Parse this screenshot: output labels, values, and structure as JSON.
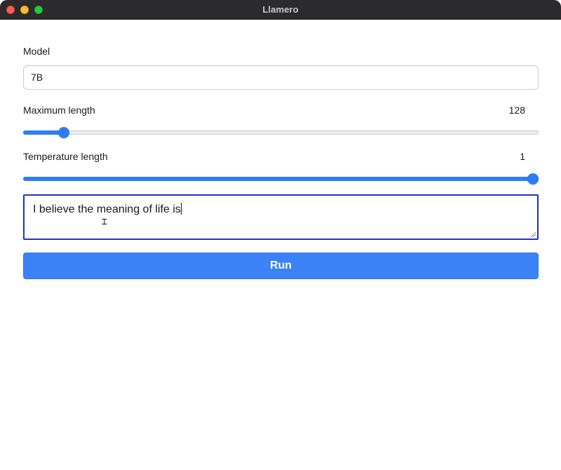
{
  "window": {
    "title": "Llamero"
  },
  "form": {
    "model_label": "Model",
    "model_value": "7B",
    "max_length_label": "Maximum length",
    "max_length_value": "128",
    "max_length_fraction": 0.07,
    "temperature_label": "Temperature length",
    "temperature_value": "1",
    "temperature_fraction": 1.0,
    "prompt_text": "I believe the meaning of life is",
    "run_label": "Run"
  },
  "colors": {
    "accent": "#2f7cf6",
    "button": "#3b82f6",
    "focus_border": "#1f33c8",
    "titlebar": "#2b2a2c"
  }
}
